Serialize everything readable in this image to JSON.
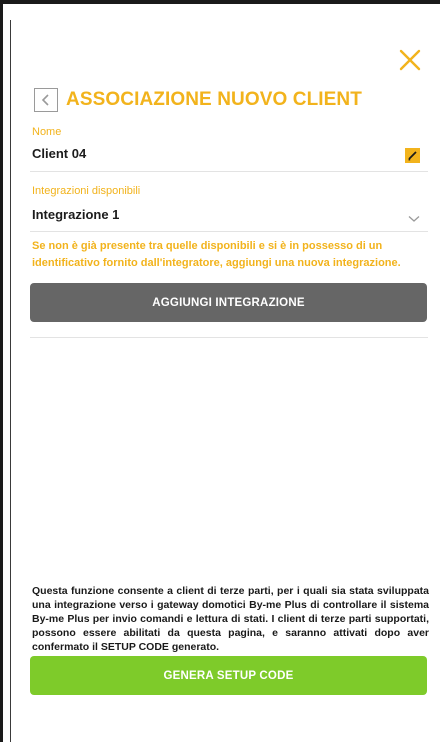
{
  "header": {
    "title": "ASSOCIAZIONE NUOVO CLIENT",
    "back_icon": "chevron-left-icon",
    "close_icon": "close-icon"
  },
  "name_field": {
    "label": "Nome",
    "value": "Client 04",
    "edit_icon": "edit-pencil-icon"
  },
  "integration_field": {
    "label": "Integrazioni disponibili",
    "selected": "Integrazione 1",
    "dropdown_icon": "chevron-down-icon"
  },
  "hint": "Se non è già presente tra quelle disponibili e si è in possesso di un identificativo fornito dall'integratore, aggiungi una nuova integrazione.",
  "buttons": {
    "add_integration": "AGGIUNGI INTEGRAZIONE",
    "generate_setup_code": "GENERA SETUP CODE"
  },
  "description": "Questa funzione consente a client di terze parti, per i quali sia stata sviluppata una integrazione verso i gateway domotici By-me Plus di controllare il sistema By-me Plus per invio comandi e lettura di stati. I client di terze parti supportati, possono essere abilitati da questa pagina, e saranno attivati dopo aver confermato il SETUP CODE generato.",
  "colors": {
    "accent": "#f2b31c",
    "add_button": "#666666",
    "generate_button": "#7ecb2a"
  }
}
